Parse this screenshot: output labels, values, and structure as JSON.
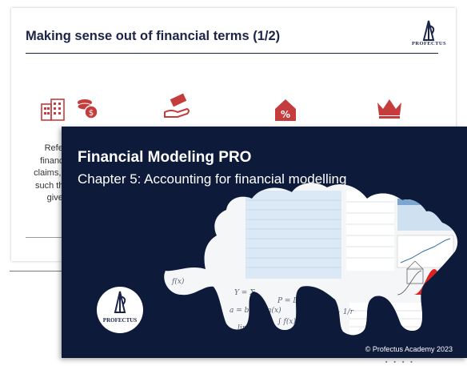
{
  "back_slide": {
    "title": "Making sense out of financial terms (1/2)",
    "logo_text": "PROFECTUS",
    "body_lines": [
      "Refers",
      "financia",
      "claims, le",
      "such thin",
      "give b"
    ],
    "colors": {
      "title": "#1c2447",
      "icons": "#c43c3c"
    },
    "icons": [
      "buildings-icon",
      "coins-icon",
      "hand-money-icon",
      "house-percent-icon",
      "crown-icon"
    ]
  },
  "front_slide": {
    "title": "Financial Modeling PRO",
    "subtitle": "Chapter 5: Accounting for financial modelling",
    "logo_text": "PROFECTUS",
    "copyright": "© Profectus Academy 2023",
    "colors": {
      "background": "#0d1a3a",
      "text": "#ffffff",
      "accent": "#e02020"
    }
  }
}
